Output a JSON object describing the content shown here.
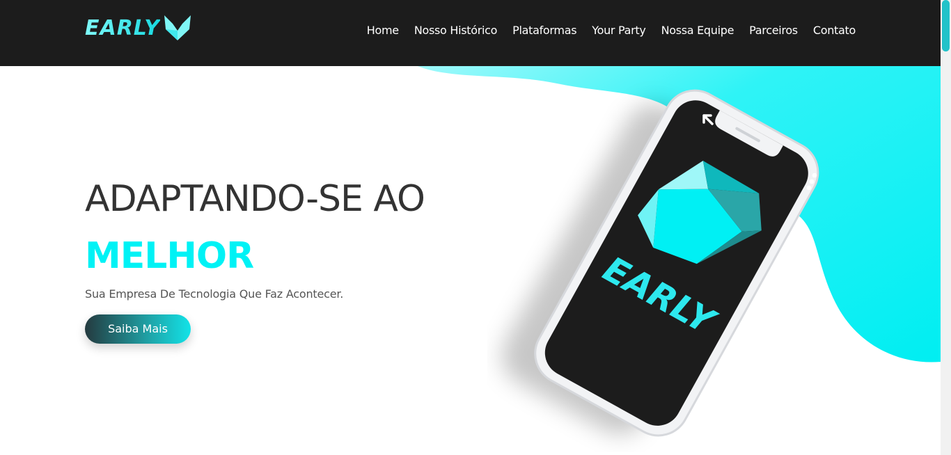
{
  "brand": {
    "logo_text": "EARLY",
    "accent_color": "#00f2f5",
    "nav_bg": "#1c1c1c"
  },
  "nav": {
    "items": [
      {
        "label": "Home"
      },
      {
        "label": "Nosso Histórico"
      },
      {
        "label": "Plataformas"
      },
      {
        "label": "Your Party"
      },
      {
        "label": "Nossa Equipe"
      },
      {
        "label": "Parceiros"
      },
      {
        "label": "Contato"
      }
    ]
  },
  "hero": {
    "headline": "ADAPTANDO-SE AO",
    "headline_accent": "MELHOR",
    "tagline": "Sua Empresa De Tecnologia Que Faz Acontecer.",
    "cta_label": "Saiba Mais"
  },
  "phone": {
    "screen_logo_text": "EARLY",
    "icons": [
      "back-arrow-icon",
      "more-options-icon",
      "fox-logo-icon"
    ]
  }
}
